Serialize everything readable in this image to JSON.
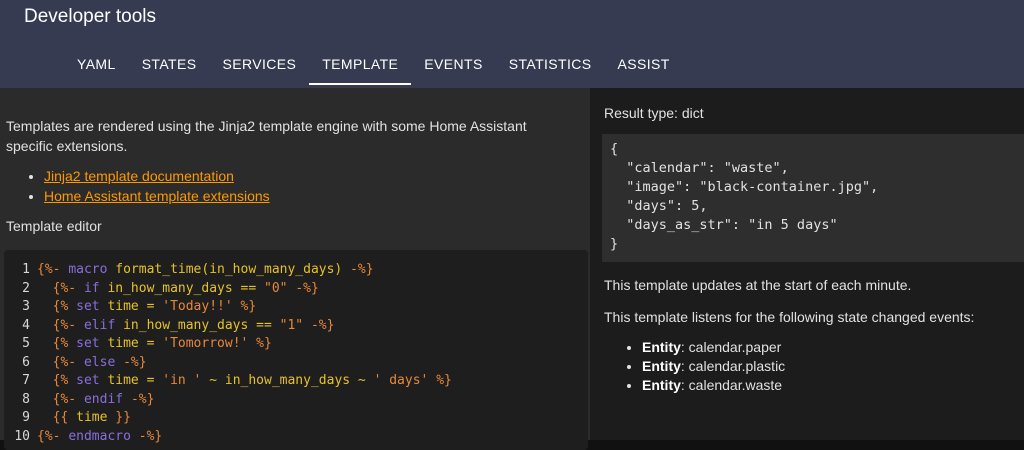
{
  "app": {
    "title": "Developer tools"
  },
  "tabs": [
    {
      "label": "YAML"
    },
    {
      "label": "STATES"
    },
    {
      "label": "SERVICES"
    },
    {
      "label": "TEMPLATE",
      "active": true
    },
    {
      "label": "EVENTS"
    },
    {
      "label": "STATISTICS"
    },
    {
      "label": "ASSIST"
    }
  ],
  "intro": {
    "text": "Templates are rendered using the Jinja2 template engine with some Home Assistant specific extensions.",
    "links": [
      {
        "label": "Jinja2 template documentation"
      },
      {
        "label": "Home Assistant template extensions"
      }
    ]
  },
  "editor": {
    "label": "Template editor",
    "lines": [
      {
        "num": "1",
        "text": "{%- macro format_time(in_how_many_days) -%}"
      },
      {
        "num": "2",
        "text": "  {%- if in_how_many_days == \"0\" -%}"
      },
      {
        "num": "3",
        "text": "  {% set time = 'Today!!' %}"
      },
      {
        "num": "4",
        "text": "  {%- elif in_how_many_days == \"1\" -%}"
      },
      {
        "num": "5",
        "text": "  {% set time = 'Tomorrow!' %}"
      },
      {
        "num": "6",
        "text": "  {%- else -%}"
      },
      {
        "num": "7",
        "text": "  {% set time = 'in ' ~ in_how_many_days ~ ' days' %}"
      },
      {
        "num": "8",
        "text": "  {%- endif -%}"
      },
      {
        "num": "9",
        "text": "  {{ time }}"
      },
      {
        "num": "10",
        "text": "{%- endmacro -%}"
      }
    ]
  },
  "result": {
    "type_label": "Result type: dict",
    "lines": [
      "{",
      "  \"calendar\": \"waste\",",
      "  \"image\": \"black-container.jpg\",",
      "  \"days\": 5,",
      "  \"days_as_str\": \"in 5 days\"",
      "}"
    ],
    "update_note": "This template updates at the start of each minute.",
    "listen_note": "This template listens for the following state changed events:",
    "entities": [
      {
        "label": "Entity",
        "value": ": calendar.paper"
      },
      {
        "label": "Entity",
        "value": ": calendar.plastic"
      },
      {
        "label": "Entity",
        "value": ": calendar.waste"
      }
    ]
  }
}
